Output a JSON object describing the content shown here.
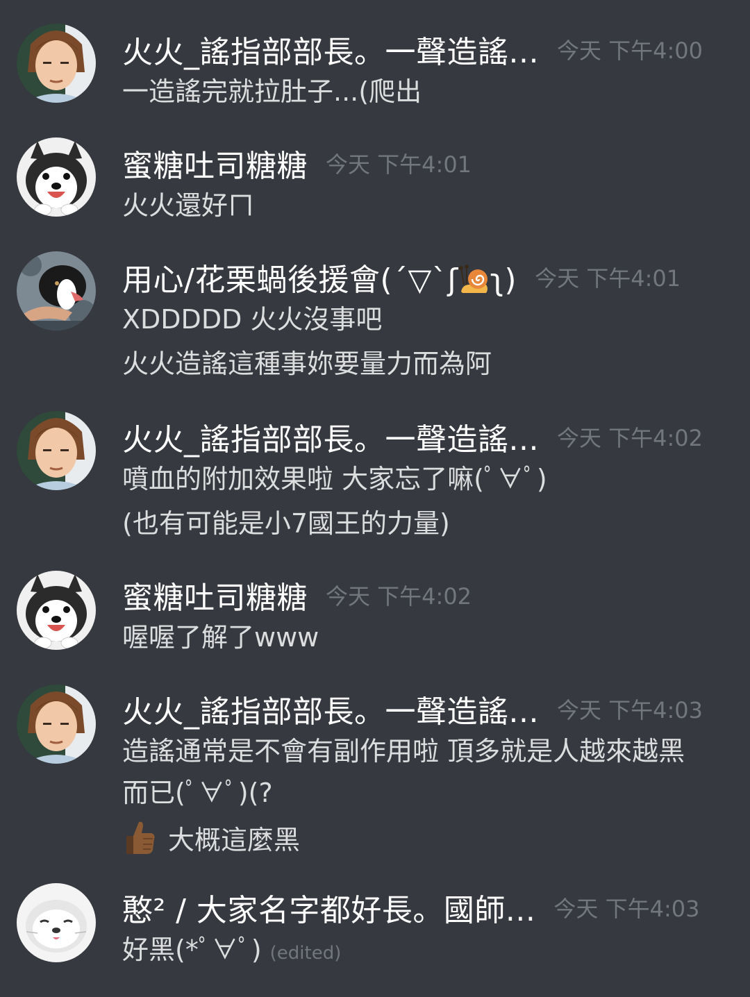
{
  "messages": [
    {
      "author": "火火_謠指部部長。一聲造謠...",
      "timestamp": "今天 下午4:00",
      "avatar": "person-avatar",
      "lines": [
        "一造謠完就拉肚子...(爬出"
      ]
    },
    {
      "author": "蜜糖吐司糖糖",
      "timestamp": "今天 下午4:01",
      "avatar": "husky-avatar",
      "lines": [
        "火火還好ㄇ"
      ]
    },
    {
      "author_prefix": "用心/花栗蝸後援會(´▽`ʃ",
      "author_suffix": "ʅ)",
      "timestamp": "今天 下午4:01",
      "avatar": "border-collie-avatar",
      "author_emoji": "snail-icon",
      "lines": [
        "XDDDDD  火火沒事吧",
        "火火造謠這種事妳要量力而為阿"
      ]
    },
    {
      "author": "火火_謠指部部長。一聲造謠...",
      "timestamp": "今天 下午4:02",
      "avatar": "person-avatar",
      "lines": [
        "噴血的附加效果啦 大家忘了嘛(ﾟ∀ﾟ)",
        "(也有可能是小7國王的力量)"
      ]
    },
    {
      "author": "蜜糖吐司糖糖",
      "timestamp": "今天 下午4:02",
      "avatar": "husky-avatar",
      "lines": [
        "喔喔了解了www"
      ]
    },
    {
      "author": "火火_謠指部部長。一聲造謠...",
      "timestamp": "今天 下午4:03",
      "avatar": "person-avatar",
      "lines": [
        "造謠通常是不會有副作用啦 頂多就是人越來越黑",
        "而已(ﾟ∀ﾟ)(?"
      ],
      "reaction": "大概這麼黑"
    },
    {
      "author": "憨² / 大家名字都好長。國師...",
      "timestamp": "今天 下午4:03",
      "avatar": "seal-avatar",
      "lines": [
        "好黑(*ﾟ∀ﾟ)"
      ],
      "edited": "(edited)"
    }
  ],
  "colors": {
    "background": "#36393f",
    "username": "#ffffff",
    "message_text": "#dcddde",
    "timestamp": "#72767d"
  }
}
